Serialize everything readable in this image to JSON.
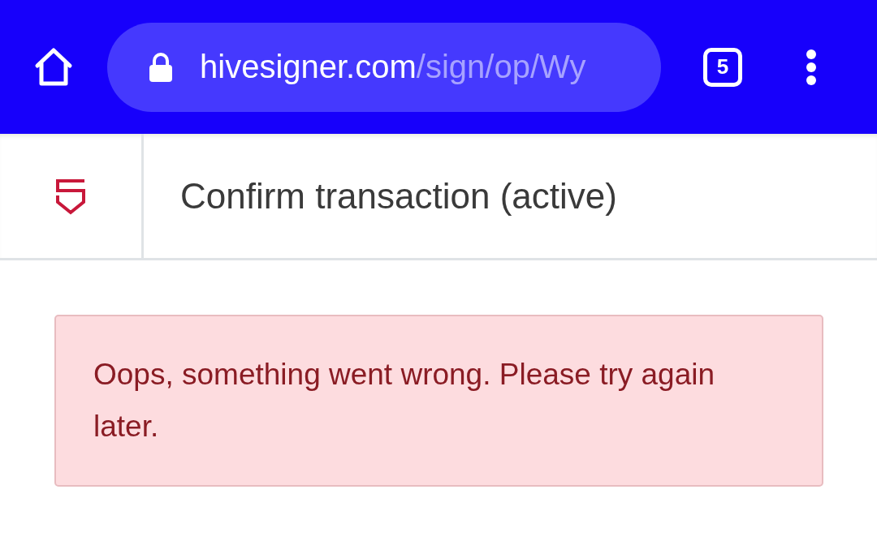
{
  "browser": {
    "url_host": "hivesigner.com",
    "url_path": "/sign/op/Wy",
    "tab_count": "5"
  },
  "header": {
    "title": "Confirm transaction (active)"
  },
  "alert": {
    "message": "Oops, something went wrong. Please try again later."
  }
}
